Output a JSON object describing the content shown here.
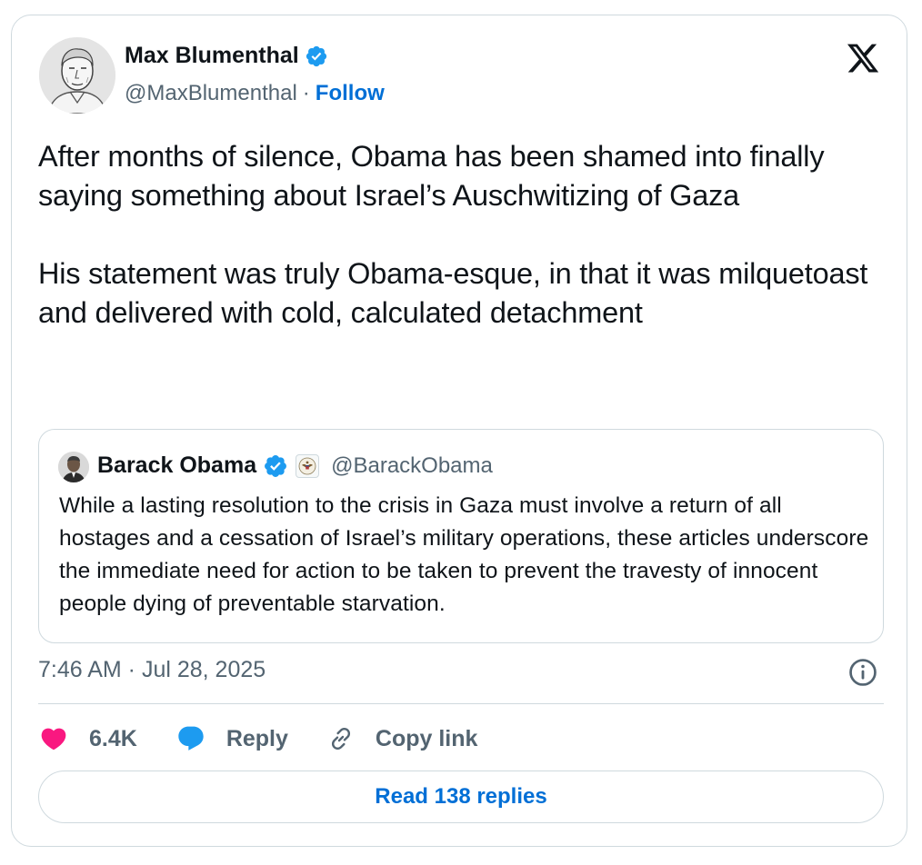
{
  "author": {
    "name": "Max Blumenthal",
    "handle": "@MaxBlumenthal",
    "separator": "·",
    "follow_label": "Follow",
    "verified": true,
    "avatar_icon": "sketch-portrait-avatar"
  },
  "platform_icon": "x-logo-icon",
  "tweet": {
    "text": "After months of silence, Obama has been shamed into finally saying something about Israel’s Auschwitizing of Gaza\n\nHis statement was truly Obama-esque, in that it was milquetoast and delivered with cold, calculated detachment"
  },
  "quoted_tweet": {
    "name": "Barack Obama",
    "handle": "@BarackObama",
    "verified": true,
    "government_badge_icon": "us-seal-icon",
    "text": "While a lasting resolution to the crisis in Gaza must involve a return of all hostages and a cessation of Israel’s military operations, these articles underscore the immediate need for action to be taken to prevent the travesty of innocent people dying of preventable starvation."
  },
  "timestamp": "7:46 AM · Jul 28, 2025",
  "actions": {
    "like_count": "6.4K",
    "reply_label": "Reply",
    "copy_link_label": "Copy link"
  },
  "read_replies_label": "Read 138 replies",
  "colors": {
    "link_blue": "#006fd6",
    "verified_blue": "#1d9bf0",
    "like_pink": "#f91880",
    "secondary_text": "#536471",
    "border": "#cfd9de"
  }
}
